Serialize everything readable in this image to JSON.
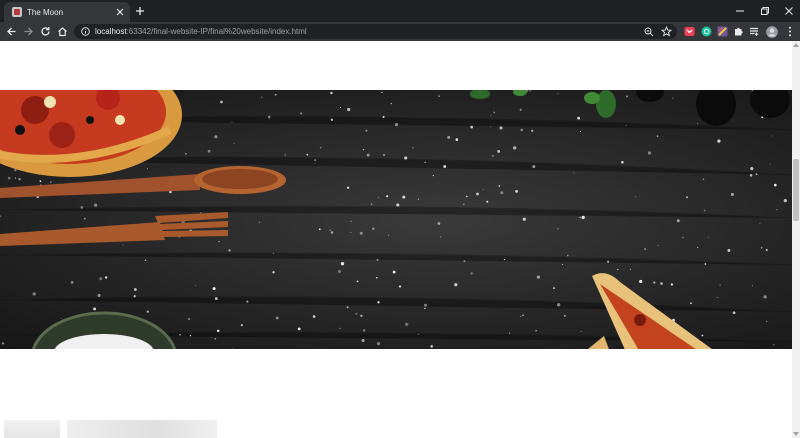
{
  "browser": {
    "tab": {
      "title": "The Moon",
      "favicon_icon": "pizza-favicon-icon",
      "close_icon": "close-icon"
    },
    "new_tab_icon": "plus-icon",
    "window_controls": [
      "minimize-icon",
      "restore-icon",
      "close-icon"
    ],
    "nav": {
      "back_icon": "arrow-left-icon",
      "forward_icon": "arrow-right-icon",
      "reload_icon": "reload-icon",
      "home_icon": "home-icon"
    },
    "omnibox": {
      "host": "localhost",
      "path": ":63342/final-website-IP/final%20website/index.html",
      "info_icon": "info-icon",
      "zoom_icon": "zoom-icon",
      "bookmark_icon": "star-icon"
    },
    "extensions": [
      "pocket-icon",
      "grammarly-icon",
      "extension-color-icon",
      "puzzle-icon",
      "reading-list-icon"
    ],
    "profile_icon": "avatar-icon",
    "menu_icon": "kebab-menu-icon"
  },
  "page": {
    "hero_image": "pizza-dark-table-banner",
    "thumbnails": [
      "thumbnail-image",
      "thumbnail-image"
    ]
  },
  "colors": {
    "chrome_dark": "#202124",
    "chrome_toolbar": "#35363a",
    "chrome_text": "#e8eaed",
    "url_path_text": "#9aa0a6",
    "hero_background": "#262626",
    "page_background": "#ffffff"
  }
}
